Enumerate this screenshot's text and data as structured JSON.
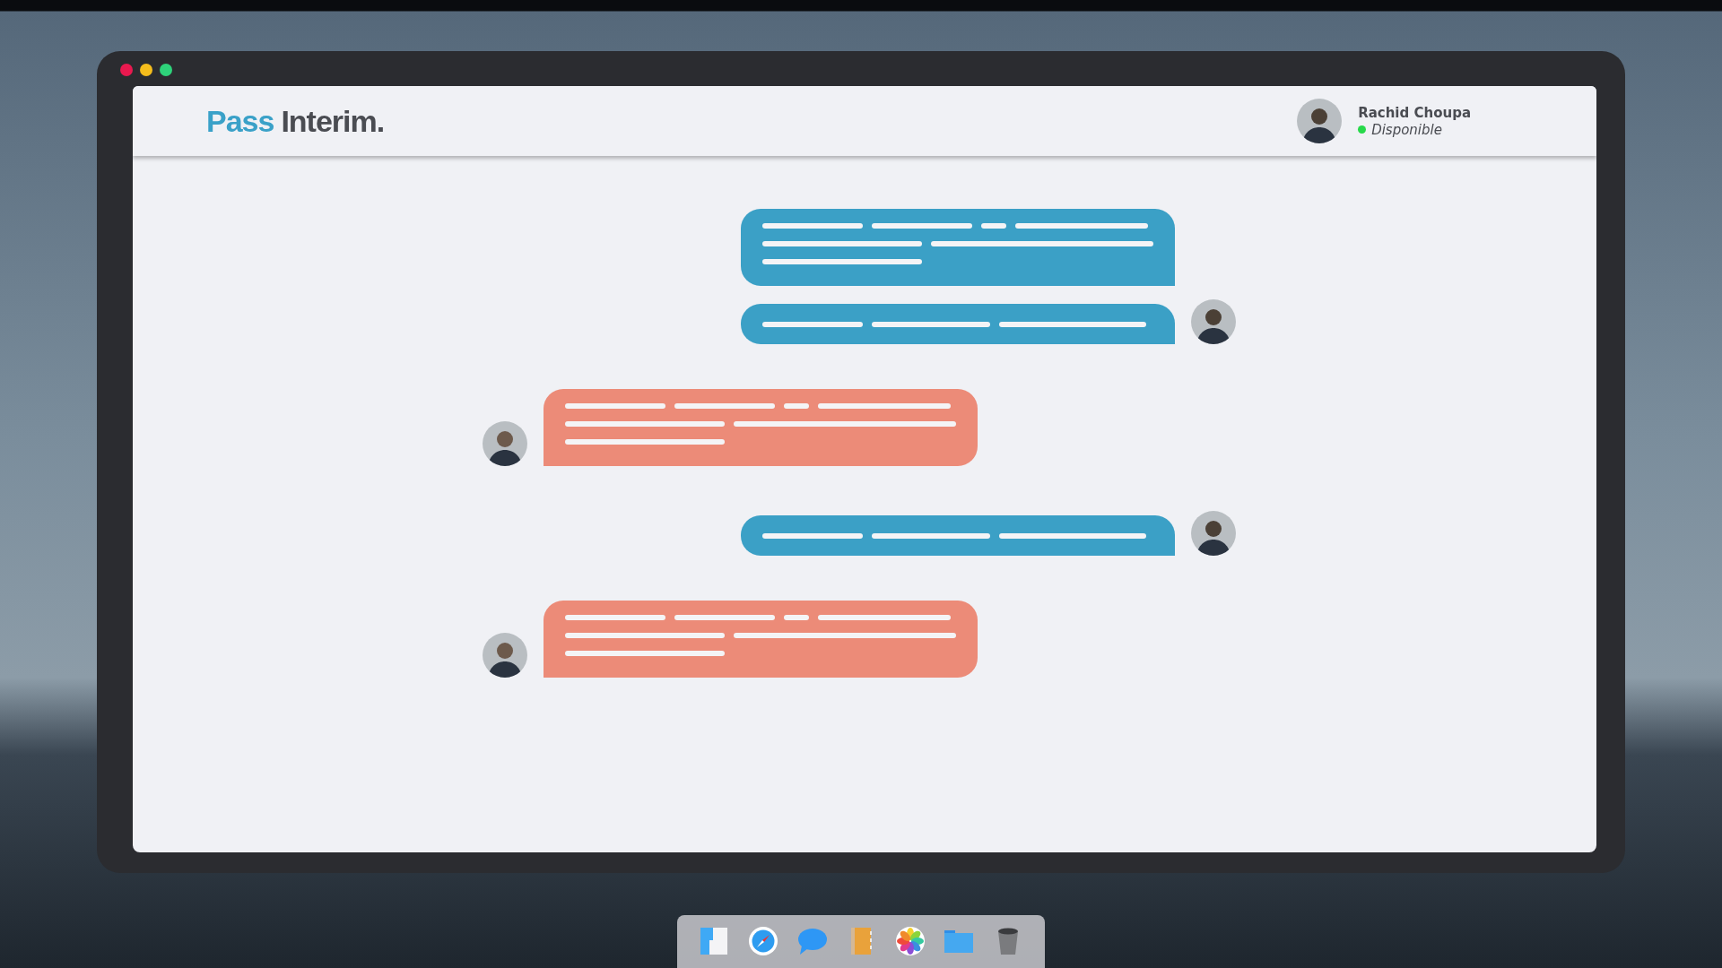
{
  "header": {
    "logo": {
      "part_1": "Pass",
      "part_2": "Interim."
    },
    "user": {
      "name": "Rachid Choupa",
      "status": "Disponible",
      "online": true
    }
  },
  "messages": [
    {
      "kind": "sent-long",
      "show_avatar": false
    },
    {
      "kind": "sent-short",
      "show_avatar": true
    },
    {
      "kind": "received-long",
      "show_avatar": true
    },
    {
      "kind": "sent-short",
      "show_avatar": true
    },
    {
      "kind": "received-long",
      "show_avatar": true
    }
  ]
}
